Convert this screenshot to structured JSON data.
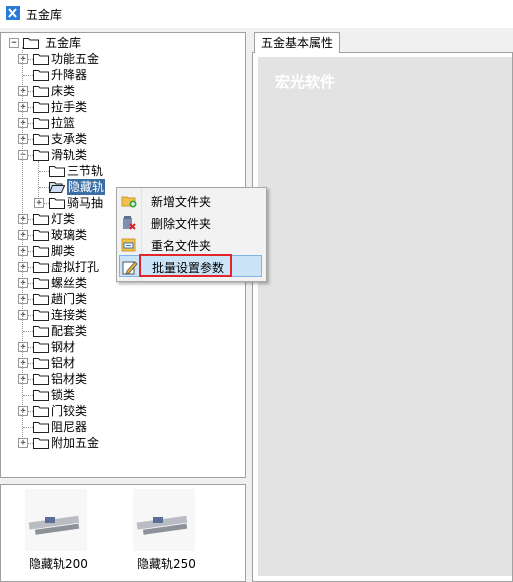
{
  "window": {
    "title": "五金库"
  },
  "tree": {
    "root": "五金库",
    "items": [
      {
        "label": "功能五金",
        "expander": "+"
      },
      {
        "label": "升降器",
        "expander": ""
      },
      {
        "label": "床类",
        "expander": "+"
      },
      {
        "label": "拉手类",
        "expander": "+"
      },
      {
        "label": "拉篮",
        "expander": "+"
      },
      {
        "label": "支承类",
        "expander": "+"
      },
      {
        "label": "滑轨类",
        "expander": "-"
      },
      {
        "label": "三节轨",
        "expander": ""
      },
      {
        "label": "隐藏轨",
        "expander": ""
      },
      {
        "label": "骑马抽",
        "expander": "+"
      },
      {
        "label": "灯类",
        "expander": "+"
      },
      {
        "label": "玻璃类",
        "expander": "+"
      },
      {
        "label": "脚类",
        "expander": "+"
      },
      {
        "label": "虚拟打孔",
        "expander": "+"
      },
      {
        "label": "螺丝类",
        "expander": "+"
      },
      {
        "label": "趟门类",
        "expander": "+"
      },
      {
        "label": "连接类",
        "expander": "+"
      },
      {
        "label": "配套类",
        "expander": ""
      },
      {
        "label": "钢材",
        "expander": "+"
      },
      {
        "label": "铝材",
        "expander": "+"
      },
      {
        "label": "铝材类",
        "expander": "+"
      },
      {
        "label": "锁类",
        "expander": ""
      },
      {
        "label": "门铰类",
        "expander": "+"
      },
      {
        "label": "阻尼器",
        "expander": ""
      },
      {
        "label": "附加五金",
        "expander": "+"
      }
    ]
  },
  "preview": {
    "items": [
      {
        "caption": "隐藏轨200"
      },
      {
        "caption": "隐藏轨250"
      }
    ]
  },
  "tabs": {
    "active": "五金基本属性"
  },
  "panel": {
    "watermark": "宏光软件"
  },
  "context_menu": {
    "items": [
      {
        "label": "新增文件夹",
        "icon": "folder-add-icon"
      },
      {
        "label": "删除文件夹",
        "icon": "folder-delete-icon"
      },
      {
        "label": "重名文件夹",
        "icon": "folder-rename-icon"
      },
      {
        "label": "批量设置参数",
        "icon": "edit-icon"
      }
    ]
  },
  "colors": {
    "selection": "#3a6ea5",
    "highlight_box": "#e0262a",
    "menu_hover": "#cce4f7"
  }
}
